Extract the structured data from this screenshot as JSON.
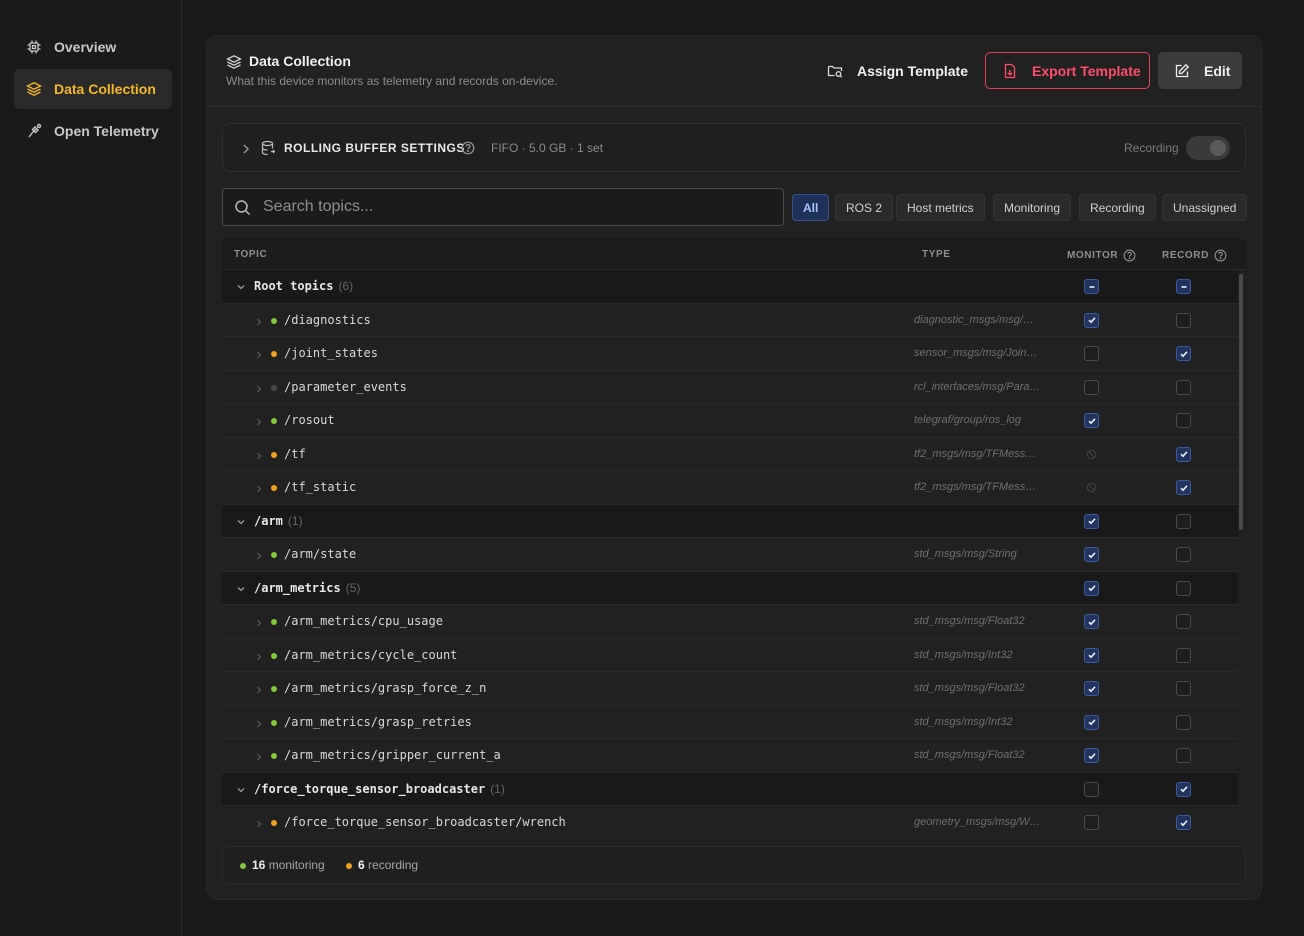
{
  "colors": {
    "accent": "#f5b825",
    "monitor_dot": "#7fc93a",
    "record_dot": "#f0a020",
    "inactive_dot": "#4a4a4a",
    "danger": "#ff4d6a",
    "checkbox_checked": "#22345e"
  },
  "sidebar": {
    "items": [
      {
        "label": "Overview",
        "icon": "cpu-chip-icon",
        "active": false
      },
      {
        "label": "Data Collection",
        "icon": "layers-icon",
        "active": true
      },
      {
        "label": "Open Telemetry",
        "icon": "telescope-icon",
        "active": false
      }
    ]
  },
  "header": {
    "title": "Data Collection",
    "subtitle": "What this device monitors as telemetry and records on-device.",
    "assign_label": "Assign Template",
    "export_label": "Export Template",
    "edit_label": "Edit"
  },
  "buffer": {
    "title": "ROLLING BUFFER SETTINGS",
    "meta": "FIFO · 5.0 GB · 1 set",
    "recording_label": "Recording",
    "recording_on": false
  },
  "search": {
    "placeholder": "Search topics..."
  },
  "filters": [
    {
      "label": "All",
      "active": true
    },
    {
      "label": "ROS 2",
      "active": false
    },
    {
      "label": "Host metrics",
      "active": false
    },
    {
      "label": "Monitoring",
      "active": false
    },
    {
      "label": "Recording",
      "active": false
    },
    {
      "label": "Unassigned",
      "active": false
    }
  ],
  "table": {
    "columns": {
      "topic": "TOPIC",
      "type": "TYPE",
      "monitor": "MONITOR",
      "record": "RECORD"
    },
    "groups": [
      {
        "name": "Root topics",
        "count": "(6)",
        "monitor": "indeterminate",
        "record": "indeterminate",
        "children": [
          {
            "name": "/diagnostics",
            "type": "diagnostic_msgs/msg/…",
            "status": "monitoring",
            "monitor": "checked",
            "record": "unchecked"
          },
          {
            "name": "/joint_states",
            "type": "sensor_msgs/msg/Join…",
            "status": "recording",
            "monitor": "unchecked",
            "record": "checked"
          },
          {
            "name": "/parameter_events",
            "type": "rcl_interfaces/msg/Para…",
            "status": "none",
            "monitor": "unchecked",
            "record": "unchecked"
          },
          {
            "name": "/rosout",
            "type": "telegraf/group/ros_log",
            "status": "monitoring",
            "monitor": "checked",
            "record": "unchecked"
          },
          {
            "name": "/tf",
            "type": "tf2_msgs/msg/TFMess…",
            "status": "recording",
            "monitor": "disabled",
            "record": "checked"
          },
          {
            "name": "/tf_static",
            "type": "tf2_msgs/msg/TFMess…",
            "status": "recording",
            "monitor": "disabled",
            "record": "checked"
          }
        ]
      },
      {
        "name": "/arm",
        "count": "(1)",
        "monitor": "checked",
        "record": "unchecked",
        "children": [
          {
            "name": "/arm/state",
            "type": "std_msgs/msg/String",
            "status": "monitoring",
            "monitor": "checked",
            "record": "unchecked"
          }
        ]
      },
      {
        "name": "/arm_metrics",
        "count": "(5)",
        "monitor": "checked",
        "record": "unchecked",
        "children": [
          {
            "name": "/arm_metrics/cpu_usage",
            "type": "std_msgs/msg/Float32",
            "status": "monitoring",
            "monitor": "checked",
            "record": "unchecked"
          },
          {
            "name": "/arm_metrics/cycle_count",
            "type": "std_msgs/msg/Int32",
            "status": "monitoring",
            "monitor": "checked",
            "record": "unchecked"
          },
          {
            "name": "/arm_metrics/grasp_force_z_n",
            "type": "std_msgs/msg/Float32",
            "status": "monitoring",
            "monitor": "checked",
            "record": "unchecked"
          },
          {
            "name": "/arm_metrics/grasp_retries",
            "type": "std_msgs/msg/Int32",
            "status": "monitoring",
            "monitor": "checked",
            "record": "unchecked"
          },
          {
            "name": "/arm_metrics/gripper_current_a",
            "type": "std_msgs/msg/Float32",
            "status": "monitoring",
            "monitor": "checked",
            "record": "unchecked"
          }
        ]
      },
      {
        "name": "/force_torque_sensor_broadcaster",
        "count": "(1)",
        "monitor": "unchecked",
        "record": "checked",
        "children": [
          {
            "name": "/force_torque_sensor_broadcaster/wrench",
            "type": "geometry_msgs/msg/W…",
            "status": "recording",
            "monitor": "unchecked",
            "record": "checked"
          }
        ]
      }
    ]
  },
  "footer": {
    "monitoring_count": "16",
    "monitoring_label": "monitoring",
    "recording_count": "6",
    "recording_label": "recording"
  }
}
